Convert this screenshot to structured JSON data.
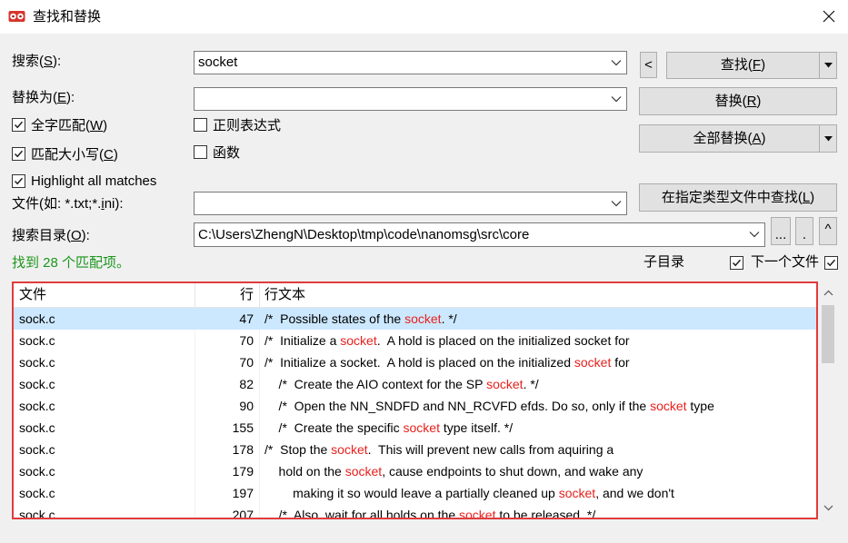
{
  "window": {
    "title": "查找和替换"
  },
  "search": {
    "label": {
      "before": "搜索(",
      "key": "S",
      "after": "):"
    },
    "value": "socket"
  },
  "replace": {
    "label": {
      "before": "替换为(",
      "key": "E",
      "after": "):"
    },
    "value": ""
  },
  "options": {
    "whole_word": {
      "label": {
        "before": "全字匹配(",
        "key": "W",
        "after": ")"
      },
      "checked": true
    },
    "regex": {
      "label": "正则表达式",
      "checked": false
    },
    "match_case": {
      "label": {
        "before": "匹配大小写(",
        "key": "C",
        "after": ")"
      },
      "checked": true
    },
    "function": {
      "label": "函数",
      "checked": false
    },
    "highlight_all": {
      "label": "Highlight all matches",
      "checked": true
    }
  },
  "file_types": {
    "label": {
      "before": "文件(如: *.txt;*.",
      "key": "i",
      "after": "ni):"
    },
    "value": ""
  },
  "directory": {
    "label": {
      "before": "搜索目录(",
      "key": "O",
      "after": "):"
    },
    "value": "C:\\Users\\ZhengN\\Desktop\\tmp\\code\\nanomsg\\src\\core"
  },
  "buttons": {
    "collapse": "<",
    "find": {
      "before": "查找(",
      "key": "F",
      "after": ")"
    },
    "replace": {
      "before": "替换(",
      "key": "R",
      "after": ")"
    },
    "replace_all": {
      "before": "全部替换(",
      "key": "A",
      "after": ")"
    },
    "find_in_files": {
      "before": "在指定类型文件中查找(",
      "key": "L",
      "after": ")"
    },
    "browse": "...",
    "current_dir": ".",
    "parent_dir": "^"
  },
  "status": {
    "text": "找到 28 个匹配项。"
  },
  "subdirectories": {
    "label": "子目录",
    "checked": true
  },
  "next_file": {
    "label": "下一个文件",
    "checked": true
  },
  "results": {
    "columns": [
      "文件",
      "行",
      "行文本"
    ],
    "selected_index": 0,
    "scroll_fraction": 0,
    "rows": [
      {
        "file": "sock.c",
        "line": "47",
        "before": "/*  Possible states of the ",
        "match": "socket",
        "after": ". */"
      },
      {
        "file": "sock.c",
        "line": "70",
        "before": "/*  Initialize a ",
        "match": "socket",
        "after": ".  A hold is placed on the initialized socket for"
      },
      {
        "file": "sock.c",
        "line": "70",
        "before": "/*  Initialize a socket.  A hold is placed on the initialized ",
        "match": "socket",
        "after": " for"
      },
      {
        "file": "sock.c",
        "line": "82",
        "before": "    /*  Create the AIO context for the SP ",
        "match": "socket",
        "after": ". */"
      },
      {
        "file": "sock.c",
        "line": "90",
        "before": "    /*  Open the NN_SNDFD and NN_RCVFD efds. Do so, only if the ",
        "match": "socket",
        "after": " type"
      },
      {
        "file": "sock.c",
        "line": "155",
        "before": "    /*  Create the specific ",
        "match": "socket",
        "after": " type itself. */"
      },
      {
        "file": "sock.c",
        "line": "178",
        "before": "/*  Stop the ",
        "match": "socket",
        "after": ".  This will prevent new calls from aquiring a"
      },
      {
        "file": "sock.c",
        "line": "179",
        "before": "    hold on the ",
        "match": "socket",
        "after": ", cause endpoints to shut down, and wake any"
      },
      {
        "file": "sock.c",
        "line": "197",
        "before": "        making it so would leave a partially cleaned up ",
        "match": "socket",
        "after": ", and we don't"
      },
      {
        "file": "sock.c",
        "line": "207",
        "before": "    /*  Also, wait for all holds on the ",
        "match": "socket",
        "after": " to be released. */"
      }
    ]
  },
  "icons": {
    "app": "app-icon",
    "close": "close-icon",
    "combo_dropdown": "chevron-down-icon",
    "split_dropdown": "triangle-down-icon",
    "scroll_up": "chevron-up-icon",
    "scroll_down": "chevron-down-icon",
    "check": "checkmark-icon"
  },
  "colors": {
    "match": "#e8201c",
    "selected_row": "#cce8ff",
    "status": "#1c961c",
    "highlight_border": "#e03c3c",
    "title_bar": "#ffffff",
    "dialog": "#f0f0f0"
  }
}
